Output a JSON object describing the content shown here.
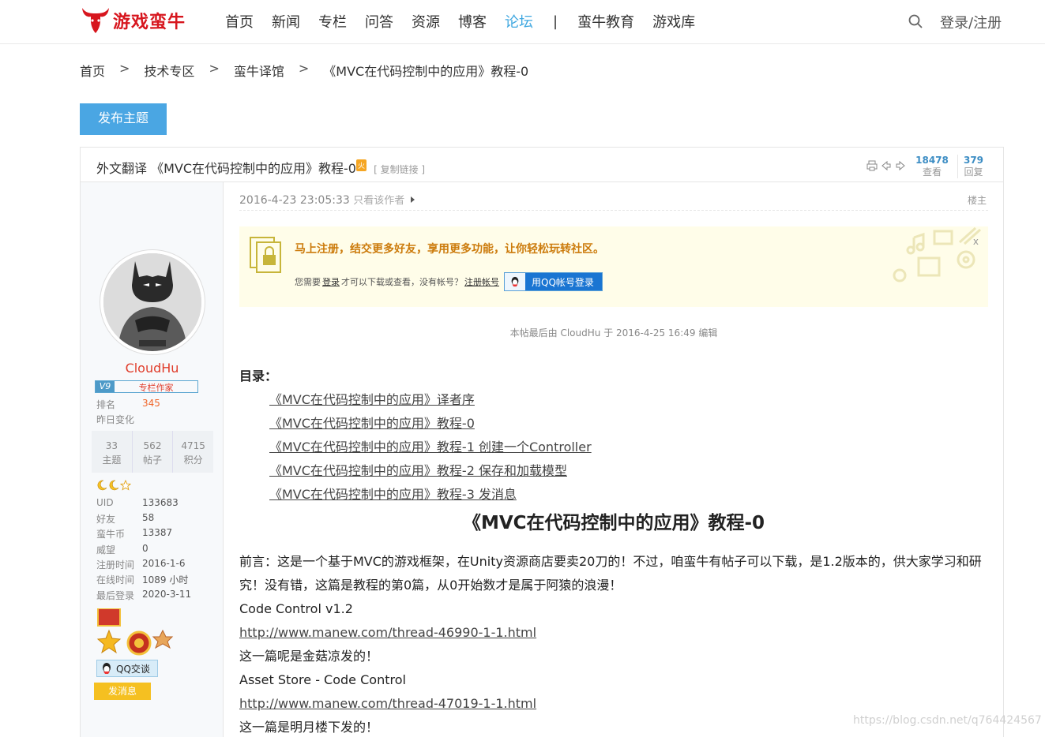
{
  "header": {
    "logo_text": "游戏蛮牛",
    "nav": [
      "首页",
      "新闻",
      "专栏",
      "问答",
      "资源",
      "博客",
      "论坛"
    ],
    "active_nav": "论坛",
    "nav_separator": "|",
    "nav_extra": [
      "蛮牛教育",
      "游戏库"
    ],
    "login": "登录/注册",
    "brand_color": "#d7161e",
    "accent_color": "#3fa7e0"
  },
  "breadcrumb": [
    "首页",
    "技术专区",
    "蛮牛译馆",
    "《MVC在代码控制中的应用》教程-0"
  ],
  "breadcrumb_sep": ">",
  "publish_button": "发布主题",
  "thread": {
    "title": "外文翻译 《MVC在代码控制中的应用》教程-0",
    "hot_badge": "火",
    "copy_link": "[ 复制链接 ]",
    "views": "18478",
    "views_label": "查看",
    "replies": "379",
    "replies_label": "回复"
  },
  "author": {
    "name": "CloudHu",
    "level": "V9",
    "title": "专栏作家",
    "rank_label": "排名",
    "rank": "345",
    "change_label": "昨日变化",
    "counts": [
      {
        "num": "33",
        "label": "主题"
      },
      {
        "num": "562",
        "label": "帖子"
      },
      {
        "num": "4715",
        "label": "积分"
      }
    ],
    "info": [
      {
        "k": "UID",
        "v": "133683"
      },
      {
        "k": "好友",
        "v": "58"
      },
      {
        "k": "蛮牛币",
        "v": "13387"
      },
      {
        "k": "威望",
        "v": "0"
      },
      {
        "k": "注册时间",
        "v": "2016-1-6"
      },
      {
        "k": "在线时间",
        "v": "1089 小时"
      },
      {
        "k": "最后登录",
        "v": "2020-3-11"
      }
    ],
    "qq_chat": "QQ交谈",
    "send_message": "发消息"
  },
  "post": {
    "date": "2016-4-23 23:05:33",
    "only_author": "只看该作者",
    "floor": "楼主",
    "register_title": "马上注册，结交更多好友，享用更多功能，让你轻松玩转社区。",
    "register_sub_1": "您需要",
    "register_login": "登录",
    "register_sub_2": "才可以下载或查看，没有帐号？",
    "register_link": "注册帐号",
    "qq_login": "用QQ帐号登录",
    "close": "x",
    "edit_note": "本帖最后由 CloudHu 于 2016-4-25 16:49 编辑",
    "toc_title": "目录：",
    "toc": [
      "《MVC在代码控制中的应用》译者序",
      "《MVC在代码控制中的应用》教程-0",
      "《MVC在代码控制中的应用》教程-1 创建一个Controller",
      "《MVC在代码控制中的应用》教程-2 保存和加载模型",
      "《MVC在代码控制中的应用》教程-3 发消息"
    ],
    "heading": "《MVC在代码控制中的应用》教程-0",
    "preface_1": "前言：这是一个基于MVC的游戏框架，在Unity资源商店要卖20刀的！不过，咱蛮牛有帖子可以下载，是1.2版本的，供大家学习和研",
    "preface_2": "究！没有错，这篇是教程的第0篇，从0开始数才是属于阿猿的浪漫！",
    "line_code_control": "Code Control v1.2",
    "link_1": "http://www.manew.com/thread-46990-1-1.html",
    "line_posted_1": "这一篇呢是金菇凉发的！",
    "line_asset_store": "Asset Store - Code Control",
    "link_2": "http://www.manew.com/thread-47019-1-1.html",
    "line_posted_2": "这一篇是明月楼下发的！"
  },
  "watermark": "https://blog.csdn.net/q764424567"
}
